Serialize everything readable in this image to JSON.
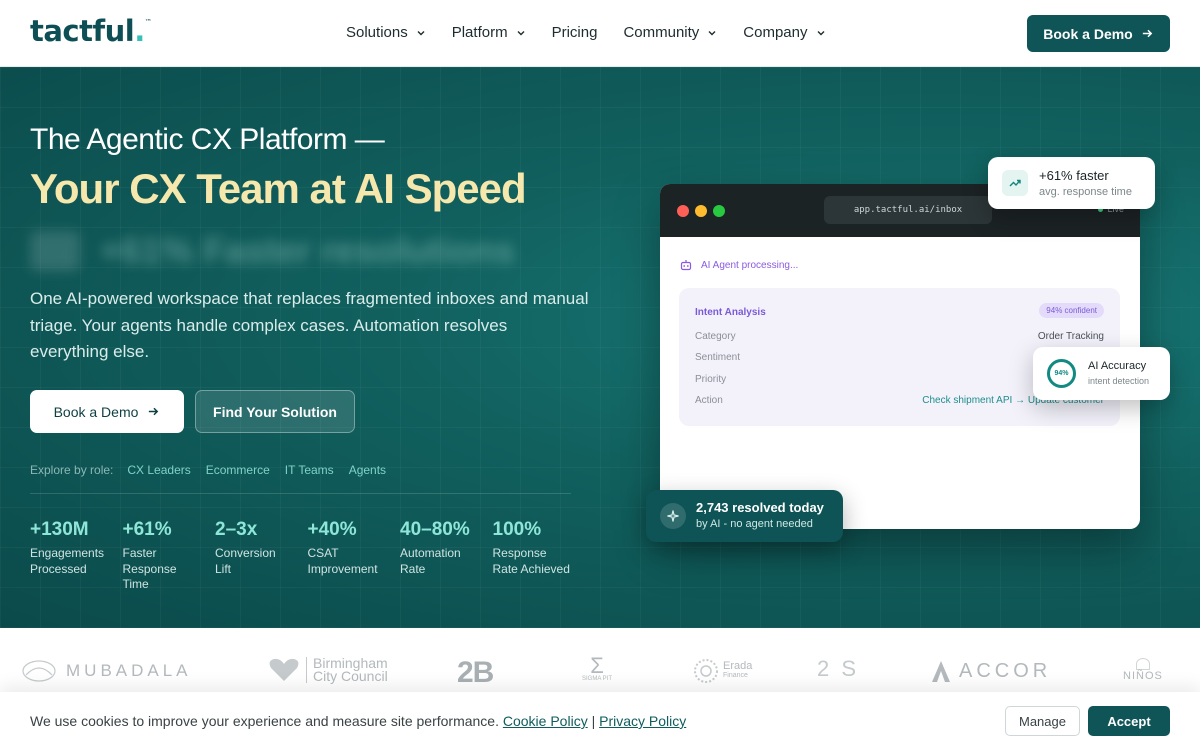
{
  "nav": {
    "logo": "tactful",
    "logo_dot": ".",
    "logo_tm": "™",
    "items": [
      {
        "label": "Solutions",
        "dropdown": true
      },
      {
        "label": "Platform",
        "dropdown": true
      },
      {
        "label": "Pricing",
        "dropdown": false
      },
      {
        "label": "Community",
        "dropdown": true
      },
      {
        "label": "Company",
        "dropdown": true
      }
    ],
    "cta": "Book a Demo"
  },
  "hero": {
    "kicker": "The Agentic CX Platform —",
    "title": "Your CX Team at AI Speed",
    "rotating_text": "+61% Faster resolutions",
    "description": "One AI-powered workspace that replaces fragmented inboxes and manual triage. Your agents handle complex cases. Automation resolves everything else.",
    "primary_cta": "Book a Demo",
    "secondary_cta": "Find Your Solution",
    "explore_label": "Explore by role:",
    "roles": [
      "CX Leaders",
      "Ecommerce",
      "IT Teams",
      "Agents"
    ],
    "stats": [
      {
        "value": "+130M",
        "label": "Engagements Processed"
      },
      {
        "value": "+61%",
        "label": "Faster Response Time"
      },
      {
        "value": "2–3x",
        "label": "Conversion Lift"
      },
      {
        "value": "+40%",
        "label": "CSAT Improvement"
      },
      {
        "value": "40–80%",
        "label": "Automation Rate"
      },
      {
        "value": "100%",
        "label": "Response Rate Achieved"
      }
    ]
  },
  "app_window": {
    "url": "app.tactful.ai/inbox",
    "live": "Live",
    "processing": "AI Agent processing...",
    "panel_title": "Intent Analysis",
    "confidence": "94% confident",
    "rows": [
      {
        "key": "Category",
        "value": "Order Tracking"
      },
      {
        "key": "Sentiment",
        "value": ""
      },
      {
        "key": "Priority",
        "value": ""
      },
      {
        "key": "Action",
        "value": "Check shipment API → Update customer"
      }
    ]
  },
  "cards": {
    "faster_title": "+61% faster",
    "faster_sub": "avg. response time",
    "accuracy_ring": "94%",
    "accuracy_title": "AI Accuracy",
    "accuracy_sub": "intent detection",
    "resolved_title": "2,743 resolved today",
    "resolved_sub": "by AI - no agent needed"
  },
  "logos": {
    "mubadala": "MUBADALA",
    "birmingham_1": "Birmingham",
    "birmingham_2": "City Council",
    "twob": "2B",
    "sigma": "SIGMA PIT",
    "erada_1": "Erada",
    "erada_2": "Finance",
    "two_s": "2 S",
    "accor": "ACCOR",
    "ninos": "NIÑOS"
  },
  "cookie": {
    "message": "We use cookies to improve your experience and measure site performance.",
    "cookie_policy": "Cookie Policy",
    "separator": "|",
    "privacy_policy": "Privacy Policy",
    "manage": "Manage",
    "accept": "Accept"
  },
  "colors": {
    "brand": "#0f5457",
    "accent_teal": "#8ee6d7",
    "title_yellow": "#f6e7ad",
    "purple": "#7b5ad6"
  }
}
